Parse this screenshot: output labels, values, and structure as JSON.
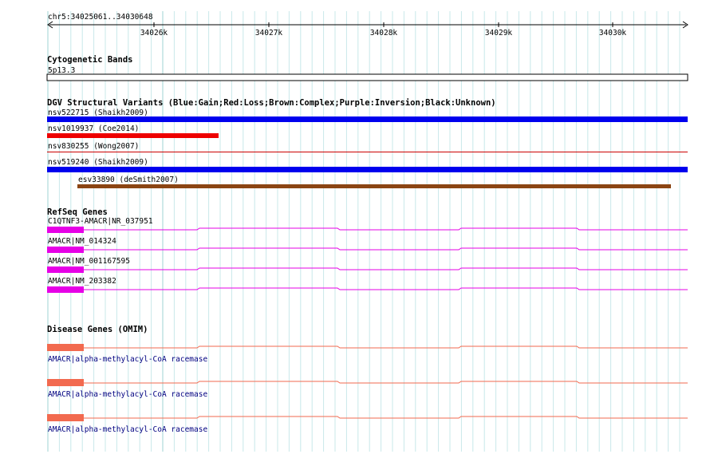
{
  "ruler": {
    "location": "chr5:34025061..34030648",
    "ticks": [
      "34026k",
      "34027k",
      "34028k",
      "34029k",
      "34030k"
    ]
  },
  "cytoband": {
    "title": "Cytogenetic Bands",
    "band": "5p13.3"
  },
  "dgv": {
    "title": "DGV Structural Variants (Blue:Gain;Red:Loss;Brown:Complex;Purple:Inversion;Black:Unknown)",
    "variants": [
      {
        "label": "nsv522715 (Shaikh2009)",
        "type": "gain",
        "color": "#0000ee"
      },
      {
        "label": "nsv1019937 (Coe2014)",
        "type": "loss",
        "color": "#ee0000"
      },
      {
        "label": "nsv830255 (Wong2007)",
        "type": "loss",
        "color": "#cc0000"
      },
      {
        "label": "nsv519240 (Shaikh2009)",
        "type": "gain",
        "color": "#0000ee"
      },
      {
        "label": "esv33890 (deSmith2007)",
        "type": "complex",
        "color": "#8b4513"
      }
    ]
  },
  "refseq": {
    "title": "RefSeq Genes",
    "color": "#e600e6",
    "genes": [
      {
        "label": "C1QTNF3-AMACR|NR_037951"
      },
      {
        "label": "AMACR|NM_014324"
      },
      {
        "label": "AMACR|NM_001167595"
      },
      {
        "label": "AMACR|NM_203382"
      }
    ]
  },
  "omim": {
    "title": "Disease Genes (OMIM)",
    "color": "#f26a4f",
    "genes": [
      {
        "label": "AMACR|alpha-methylacyl-CoA racemase"
      },
      {
        "label": "AMACR|alpha-methylacyl-CoA racemase"
      },
      {
        "label": "AMACR|alpha-methylacyl-CoA racemase"
      }
    ]
  }
}
